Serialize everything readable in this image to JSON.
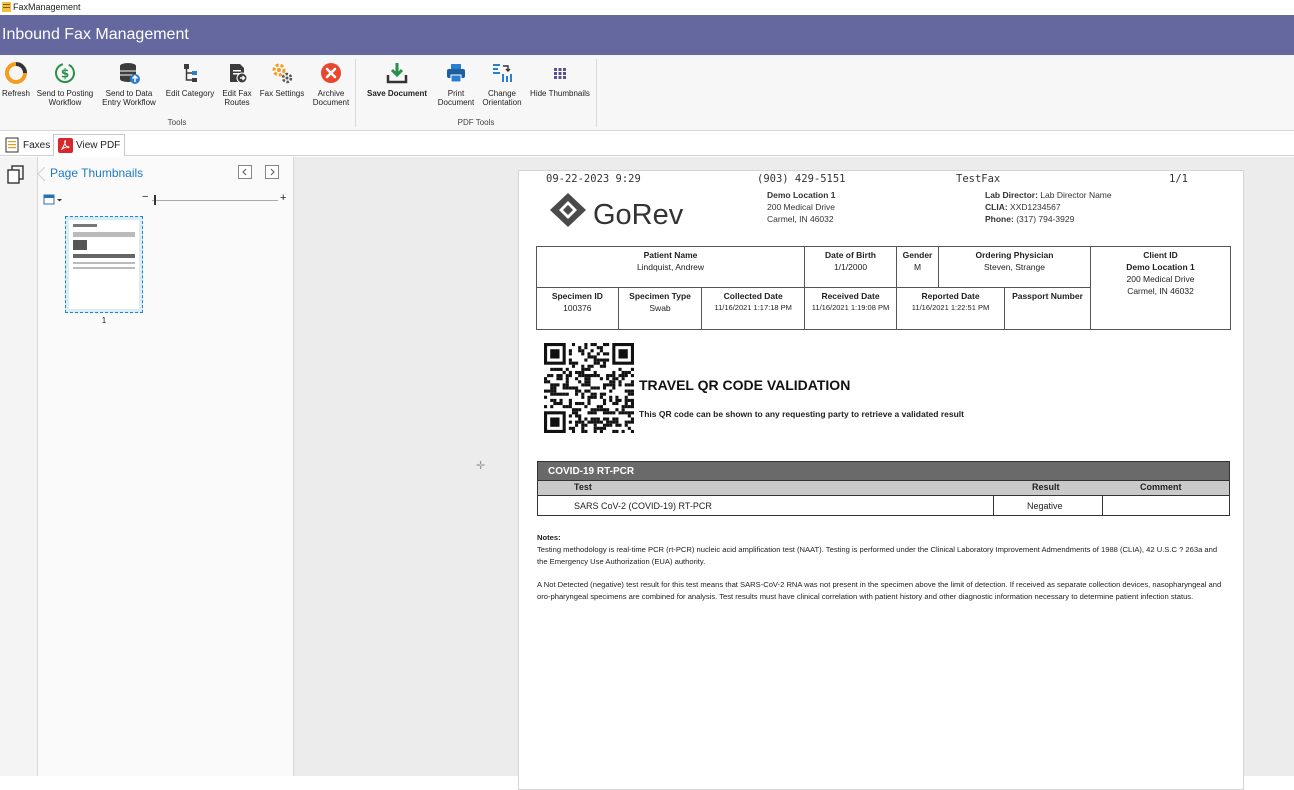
{
  "window": {
    "title": "FaxManagement"
  },
  "banner": {
    "title": "Inbound Fax Management"
  },
  "ribbon": {
    "buttons": [
      {
        "label": "Refresh",
        "icon": "refresh-icon"
      },
      {
        "label": "Send to Posting\nWorkflow",
        "icon": "dollar-cycle-icon"
      },
      {
        "label": "Send to Data\nEntry Workflow",
        "icon": "database-icon"
      },
      {
        "label": "Edit Category",
        "icon": "category-tree-icon"
      },
      {
        "label": "Edit Fax\nRoutes",
        "icon": "fax-routes-icon"
      },
      {
        "label": "Fax Settings",
        "icon": "gears-icon"
      },
      {
        "label": "Archive\nDocument",
        "icon": "archive-x-icon"
      },
      {
        "label": "Save Document",
        "icon": "download-icon"
      },
      {
        "label": "Print\nDocument",
        "icon": "printer-icon"
      },
      {
        "label": "Change\nOrientation",
        "icon": "orientation-icon"
      },
      {
        "label": "Hide Thumbnails",
        "icon": "thumbnails-grid-icon"
      }
    ],
    "groups": {
      "tools": "Tools",
      "pdf_tools": "PDF Tools"
    }
  },
  "tabs": [
    {
      "label": "Faxes",
      "icon": "document-list-icon"
    },
    {
      "label": "View PDF",
      "icon": "pdf-icon"
    }
  ],
  "thumbnails": {
    "title": "Page Thumbnails",
    "page_number": "1"
  },
  "colors": {
    "banner": "#65679f",
    "link_blue": "#1c7bc4",
    "covid_header": "#6a6a6a"
  },
  "fax": {
    "header": {
      "datetime": "09-22-2023 9:29",
      "phone": "(903) 429-5151",
      "sender": "TestFax",
      "page": "1/1"
    },
    "logo": "GoRev",
    "location": {
      "name": "Demo Location 1",
      "address1": "200 Medical Drive",
      "address2": "Carmel, IN 46032"
    },
    "lab": {
      "director_label": "Lab Director:",
      "director": "Lab Director Name",
      "clia_label": "CLIA:",
      "clia": "XXD1234567",
      "phone_label": "Phone:",
      "phone": "(317) 794-3929"
    },
    "patient": {
      "name_label": "Patient Name",
      "name": "Lindquist, Andrew",
      "dob_label": "Date of Birth",
      "dob": "1/1/2000",
      "gender_label": "Gender",
      "gender": "M",
      "physician_label": "Ordering Physician",
      "physician": "Steven, Strange",
      "client_label": "Client ID",
      "client_name": "Demo Location 1",
      "client_addr1": "200 Medical Drive",
      "client_addr2": "Carmel, IN 46032",
      "specimen_id_label": "Specimen ID",
      "specimen_id": "100376",
      "specimen_type_label": "Specimen Type",
      "specimen_type": "Swab",
      "collected_label": "Collected Date",
      "collected": "11/16/2021 1:17:18 PM",
      "received_label": "Received Date",
      "received": "11/16/2021 1:19:08 PM",
      "reported_label": "Reported Date",
      "reported": "11/16/2021 1:22:51 PM",
      "passport_label": "Passport Number",
      "passport": ""
    },
    "qr": {
      "title": "TRAVEL QR CODE VALIDATION",
      "subtitle": "This QR code can be shown to any requesting party to retrieve a validated result"
    },
    "covid": {
      "header": "COVID-19 RT-PCR",
      "col_test": "Test",
      "col_result": "Result",
      "col_comment": "Comment",
      "test": "SARS CoV-2 (COVID-19) RT-PCR",
      "result": "Negative",
      "comment": ""
    },
    "notes": {
      "label": "Notes:",
      "p1": "Testing methodology is real-time PCR (rt-PCR) nucleic acid amplification test (NAAT). Testing is performed under the Clinical Laboratory Improvement Admendments of 1988 (CLIA), 42 U.S.C ? 263a and the Emergency Use Authorization (EUA) authority.",
      "p2": "A Not Detected (negative) test result for this test means that SARS-CoV-2 RNA was not present in the specimen above the limit of detection. If received as separate collection devices, nasopharyngeal and oro-pharyngeal specimens are combined for analysis. Test results must have clinical correlation with patient history and other diagnostic information necessary to determine patient infection status."
    }
  }
}
